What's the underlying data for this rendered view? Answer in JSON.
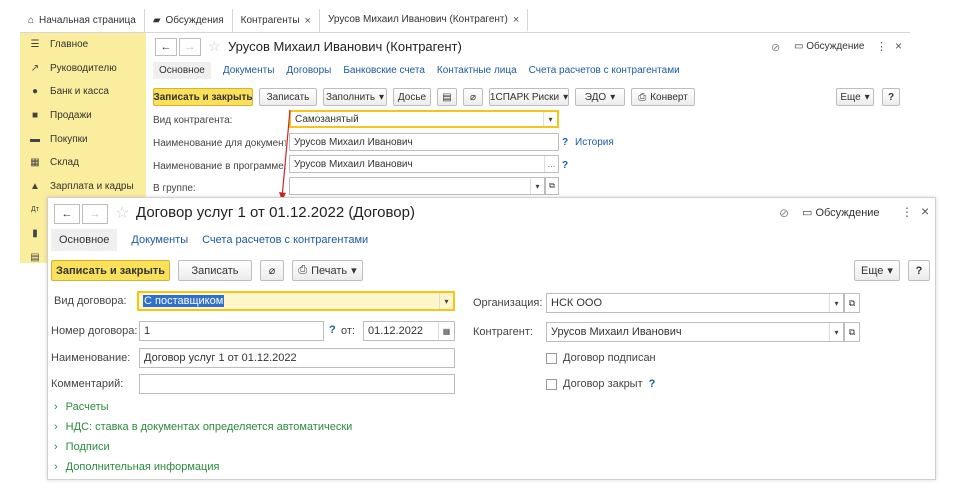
{
  "tabs": [
    {
      "label": "Начальная страница",
      "icon": "home-icon"
    },
    {
      "label": "Обсуждения",
      "icon": "chat-icon"
    },
    {
      "label": "Контрагенты",
      "close": "×"
    },
    {
      "label": "Урусов Михаил Иванович (Контрагент)",
      "close": "×"
    }
  ],
  "sidebar": [
    {
      "label": "Главное",
      "icon": "menu-icon"
    },
    {
      "label": "Руководителю",
      "icon": "trend-icon"
    },
    {
      "label": "Банк и касса",
      "icon": "coins-icon"
    },
    {
      "label": "Продажи",
      "icon": "bag-icon"
    },
    {
      "label": "Покупки",
      "icon": "cart-icon"
    },
    {
      "label": "Склад",
      "icon": "warehouse-icon"
    },
    {
      "label": "Зарплата и кадры",
      "icon": "person-icon"
    },
    {
      "label": "Дт Кт",
      "icon": "accounting-icon"
    },
    {
      "label": "",
      "icon": "chart-icon"
    },
    {
      "label": "",
      "icon": "book-icon"
    }
  ],
  "back": {
    "title": "Урусов Михаил Иванович (Контрагент)",
    "discuss": "Обсуждение",
    "more": "⋮",
    "close": "×",
    "tabs": [
      "Основное",
      "Документы",
      "Договоры",
      "Банковские счета",
      "Контактные лица",
      "Счета расчетов с контрагентами"
    ],
    "toolbar": {
      "save_close": "Записать и закрыть",
      "save": "Записать",
      "fill": "Заполнить",
      "dossier": "Досье",
      "spark": "1СПАРК Риски",
      "edo": "ЭДО",
      "envelope": "Конверт",
      "more": "Еще",
      "help": "?"
    },
    "fields": {
      "kind_label": "Вид контрагента:",
      "kind_value": "Самозанятый",
      "doc_name_label": "Наименование для документов:",
      "doc_name_value": "Урусов Михаил Иванович",
      "prog_name_label": "Наименование в программе:",
      "prog_name_value": "Урусов Михаил Иванович",
      "group_label": "В группе:",
      "group_value": "",
      "history": "История",
      "q": "?"
    }
  },
  "front": {
    "title": "Договор услуг 1 от 01.12.2022 (Договор)",
    "discuss": "Обсуждение",
    "more": "⋮",
    "close": "×",
    "tabs": [
      "Основное",
      "Документы",
      "Счета расчетов с контрагентами"
    ],
    "toolbar": {
      "save_close": "Записать и закрыть",
      "save": "Записать",
      "print": "Печать",
      "more": "Еще",
      "help": "?"
    },
    "fields": {
      "kind_label": "Вид договора:",
      "kind_value": "С поставщиком",
      "number_label": "Номер договора:",
      "number_value": "1",
      "q": "?",
      "from_label": "от:",
      "date_value": "01.12.2022",
      "name_label": "Наименование:",
      "name_value": "Договор услуг 1 от 01.12.2022",
      "comment_label": "Комментарий:",
      "comment_value": "",
      "org_label": "Организация:",
      "org_value": "НСК ООО",
      "cp_label": "Контрагент:",
      "cp_value": "Урусов Михаил Иванович",
      "signed_label": "Договор подписан",
      "closed_label": "Договор закрыт"
    },
    "groups": [
      "Расчеты",
      "НДС: ставка в документах определяется автоматически",
      "Подписи",
      "Дополнительная информация"
    ]
  },
  "colors": {
    "accent_yellow": "#fbe05a",
    "sidebar": "#fbed9e",
    "link": "#1c5ba0",
    "group": "#2b8a3e",
    "arrow": "#c62828"
  }
}
